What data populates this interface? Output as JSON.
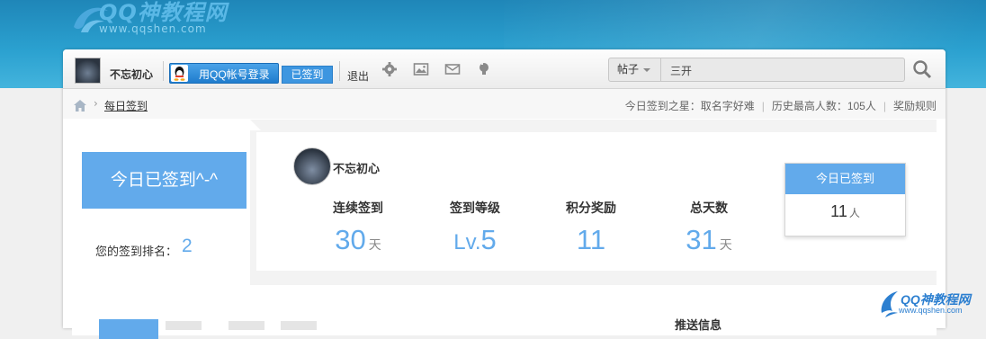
{
  "brand": {
    "title": "QQ神教程网",
    "url": "www.qqshen.com"
  },
  "toolbar": {
    "username": "不忘初心",
    "qq_login_label": "用QQ帐号登录",
    "signed_label": "已签到",
    "logout_label": "退出",
    "icons": [
      "gear-icon",
      "picture-icon",
      "mail-icon",
      "lightbulb-icon"
    ]
  },
  "search": {
    "category": "帖子",
    "value": "三开"
  },
  "breadcrumb": {
    "current": "每日签到",
    "star": "今日签到之星：取名字好难",
    "record": "历史最高人数：105人",
    "rules": "奖励规则"
  },
  "signin": {
    "big_label": "今日已签到^-^",
    "rank_label": "您的签到排名：",
    "rank_value": "2"
  },
  "profile": {
    "username": "不忘初心"
  },
  "stats": [
    {
      "label": "连续签到",
      "prefix": "",
      "value": "30",
      "unit": "天"
    },
    {
      "label": "签到等级",
      "prefix": "Lv.",
      "value": "5",
      "unit": ""
    },
    {
      "label": "积分奖励",
      "prefix": "",
      "value": "11",
      "unit": ""
    },
    {
      "label": "总天数",
      "prefix": "",
      "value": "31",
      "unit": "天"
    }
  ],
  "today": {
    "title": "今日已签到",
    "count": "11",
    "unit": "人"
  },
  "bottom": {
    "push_title": "推送信息"
  },
  "watermark": {
    "title": "QQ神教程网",
    "url": "www.qqshen.com"
  },
  "colors": {
    "accent": "#62aaeb",
    "header": "#2aa0cf"
  }
}
